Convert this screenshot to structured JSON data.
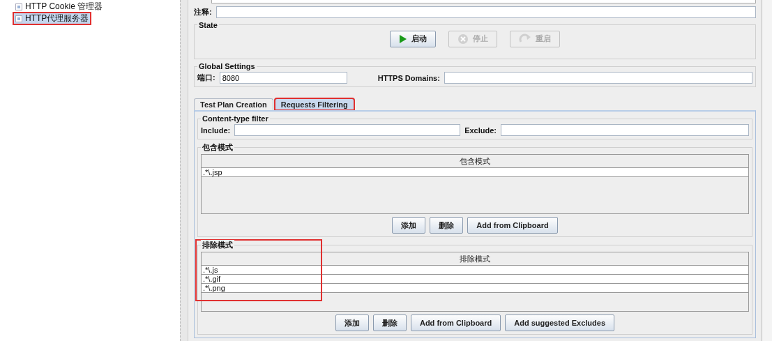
{
  "tree": {
    "items": [
      {
        "label": "HTTP Cookie 管理器",
        "selected": false,
        "highlighted": false
      },
      {
        "label": "HTTP代理服务器",
        "selected": true,
        "highlighted": true
      }
    ]
  },
  "comment": {
    "label": "注释:"
  },
  "state": {
    "title": "State",
    "buttons": [
      {
        "label": "启动",
        "kind": "start",
        "disabled": false
      },
      {
        "label": "停止",
        "kind": "stop",
        "disabled": true
      },
      {
        "label": "重启",
        "kind": "restart",
        "disabled": true
      }
    ]
  },
  "global_settings": {
    "title": "Global Settings",
    "port_label": "端口:",
    "port_value": "8080",
    "https_label": "HTTPS Domains:"
  },
  "tabs": [
    {
      "label": "Test Plan Creation",
      "selected": false,
      "highlighted": false
    },
    {
      "label": "Requests Filtering",
      "selected": true,
      "highlighted": true
    }
  ],
  "content_type_filter": {
    "title": "Content-type filter",
    "include_label": "Include:",
    "exclude_label": "Exclude:"
  },
  "pattern_groups": [
    {
      "title": "包含模式",
      "highlighted": false,
      "column": "包含模式",
      "rows": [
        ".*\\.jsp"
      ],
      "buttons": [
        "添加",
        "删除",
        "Add from Clipboard"
      ]
    },
    {
      "title": "排除模式",
      "highlighted": true,
      "column": "排除模式",
      "rows": [
        ".*\\.js",
        ".*\\.gif",
        ".*\\.png"
      ],
      "buttons": [
        "添加",
        "删除",
        "Add from Clipboard",
        "Add suggested Excludes"
      ]
    }
  ]
}
